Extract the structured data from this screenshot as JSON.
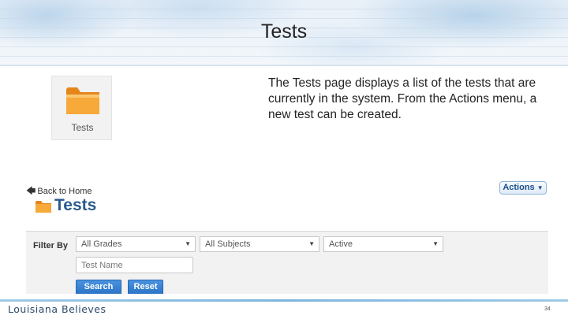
{
  "slide": {
    "title": "Tests",
    "description": "The Tests page displays a list of the tests that are currently in the system. From the Actions menu, a new test can be created.",
    "page_number": "34",
    "brand": "Louisiana Believes"
  },
  "tile": {
    "label": "Tests",
    "icon": "folder-icon"
  },
  "app": {
    "back_link": "Back to Home",
    "actions_label": "Actions",
    "heading": "Tests",
    "filter": {
      "label": "Filter By",
      "grades": "All Grades",
      "subjects": "All Subjects",
      "status": "Active",
      "test_name_placeholder": "Test Name",
      "search_label": "Search",
      "reset_label": "Reset"
    }
  },
  "colors": {
    "heading_blue": "#2b5a8c",
    "button_blue": "#2b74c7",
    "folder_orange": "#f29a1f"
  }
}
